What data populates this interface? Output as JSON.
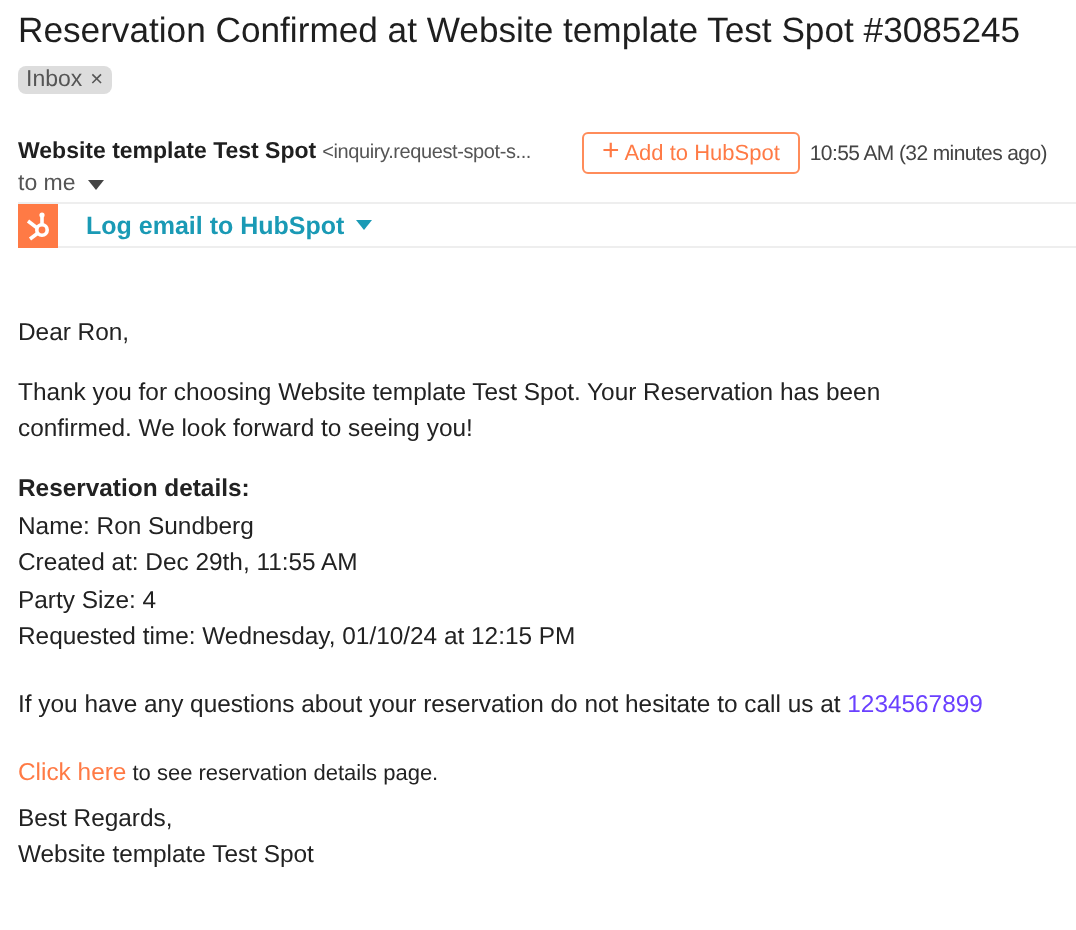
{
  "subject": "Reservation Confirmed at Website template Test Spot #3085245",
  "labels": [
    {
      "text": "Inbox",
      "remove": "×"
    }
  ],
  "sender": {
    "name": "Website template Test Spot",
    "address": "<inquiry.request-spot-s...",
    "recipient": "to me"
  },
  "add_button": {
    "icon": "+",
    "label": "Add to HubSpot"
  },
  "time": "10:55 AM (32 minutes ago)",
  "log_bar": {
    "label": "Log email to HubSpot"
  },
  "body": [
    {
      "kind": "para",
      "text": "Dear Ron,"
    },
    {
      "kind": "para",
      "text": "Thank you for choosing Website template Test Spot. Your Reservation has been confirmed. We look forward to seeing you!"
    },
    {
      "kind": "heading",
      "text": "Reservation details:"
    },
    {
      "kind": "line",
      "text": "Name: Ron Sundberg"
    },
    {
      "kind": "line",
      "text": "Created at: Dec 29th, 11:55 AM"
    },
    {
      "kind": "line",
      "text": "Party Size: 4"
    },
    {
      "kind": "line",
      "text": "Requested time: Wednesday, 01/10/24 at 12:15 PM"
    },
    {
      "kind": "linkend",
      "text": "If you have any questions about your reservation do not hesitate to call us at ",
      "link": "1234567899"
    },
    {
      "kind": "linkstart",
      "link": "Click here",
      "text": " to see reservation details page."
    },
    {
      "kind": "sign",
      "text": "Best Regards,"
    },
    {
      "kind": "line",
      "text": "Website template Test Spot"
    }
  ]
}
